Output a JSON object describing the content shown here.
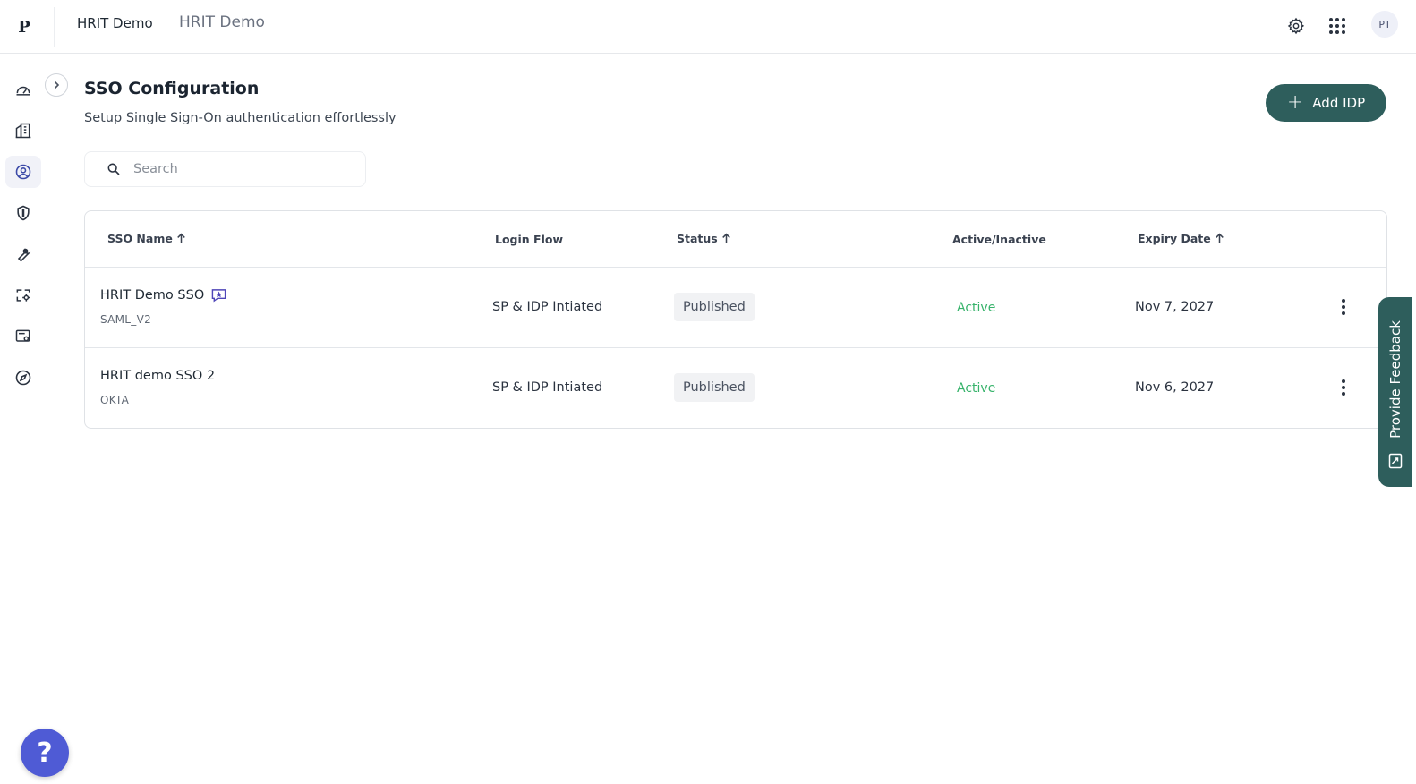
{
  "header": {
    "logo_letter": "P",
    "org_name": "HRIT Demo",
    "app_name": "HRIT Demo",
    "avatar_initials": "PT"
  },
  "icons": {
    "settings": "gear-icon",
    "apps": "grid-icon",
    "search": "search-icon",
    "collapse": "chevron-right-icon",
    "help": "question-icon",
    "feedback": "feedback-icon"
  },
  "sidebar": {
    "items": [
      {
        "icon": "dashboard-icon"
      },
      {
        "icon": "building-icon"
      },
      {
        "icon": "user-circle-icon",
        "active": true
      },
      {
        "icon": "shield-icon"
      },
      {
        "icon": "wrench-icon"
      },
      {
        "icon": "flow-settings-icon"
      },
      {
        "icon": "screen-settings-icon"
      },
      {
        "icon": "compass-icon"
      }
    ],
    "help_label": "?"
  },
  "main": {
    "title": "SSO Configuration",
    "subtitle": "Setup Single Sign-On authentication effortlessly",
    "add_button_label": "Add IDP",
    "search_placeholder": "Search"
  },
  "table": {
    "columns": [
      "SSO Name",
      "Login Flow",
      "Status",
      "Active/Inactive",
      "Expiry Date"
    ],
    "rows": [
      {
        "name": "HRIT Demo SSO",
        "type": "SAML_V2",
        "login_flow": "SP & IDP Intiated",
        "status": "Published",
        "active": "Active",
        "expiry": "Nov 7, 2027",
        "badge": true
      },
      {
        "name": "HRIT demo SSO 2",
        "type": "OKTA",
        "login_flow": "SP & IDP Intiated",
        "status": "Published",
        "active": "Active",
        "expiry": "Nov 6, 2027",
        "badge": false
      }
    ]
  },
  "feedback": {
    "label": "Provide Feedback"
  },
  "colors": {
    "primary": "#2e5e5c",
    "active_green": "#37b36b",
    "help_blue": "#4f5bd5",
    "badge_purple": "#4f46b8"
  }
}
